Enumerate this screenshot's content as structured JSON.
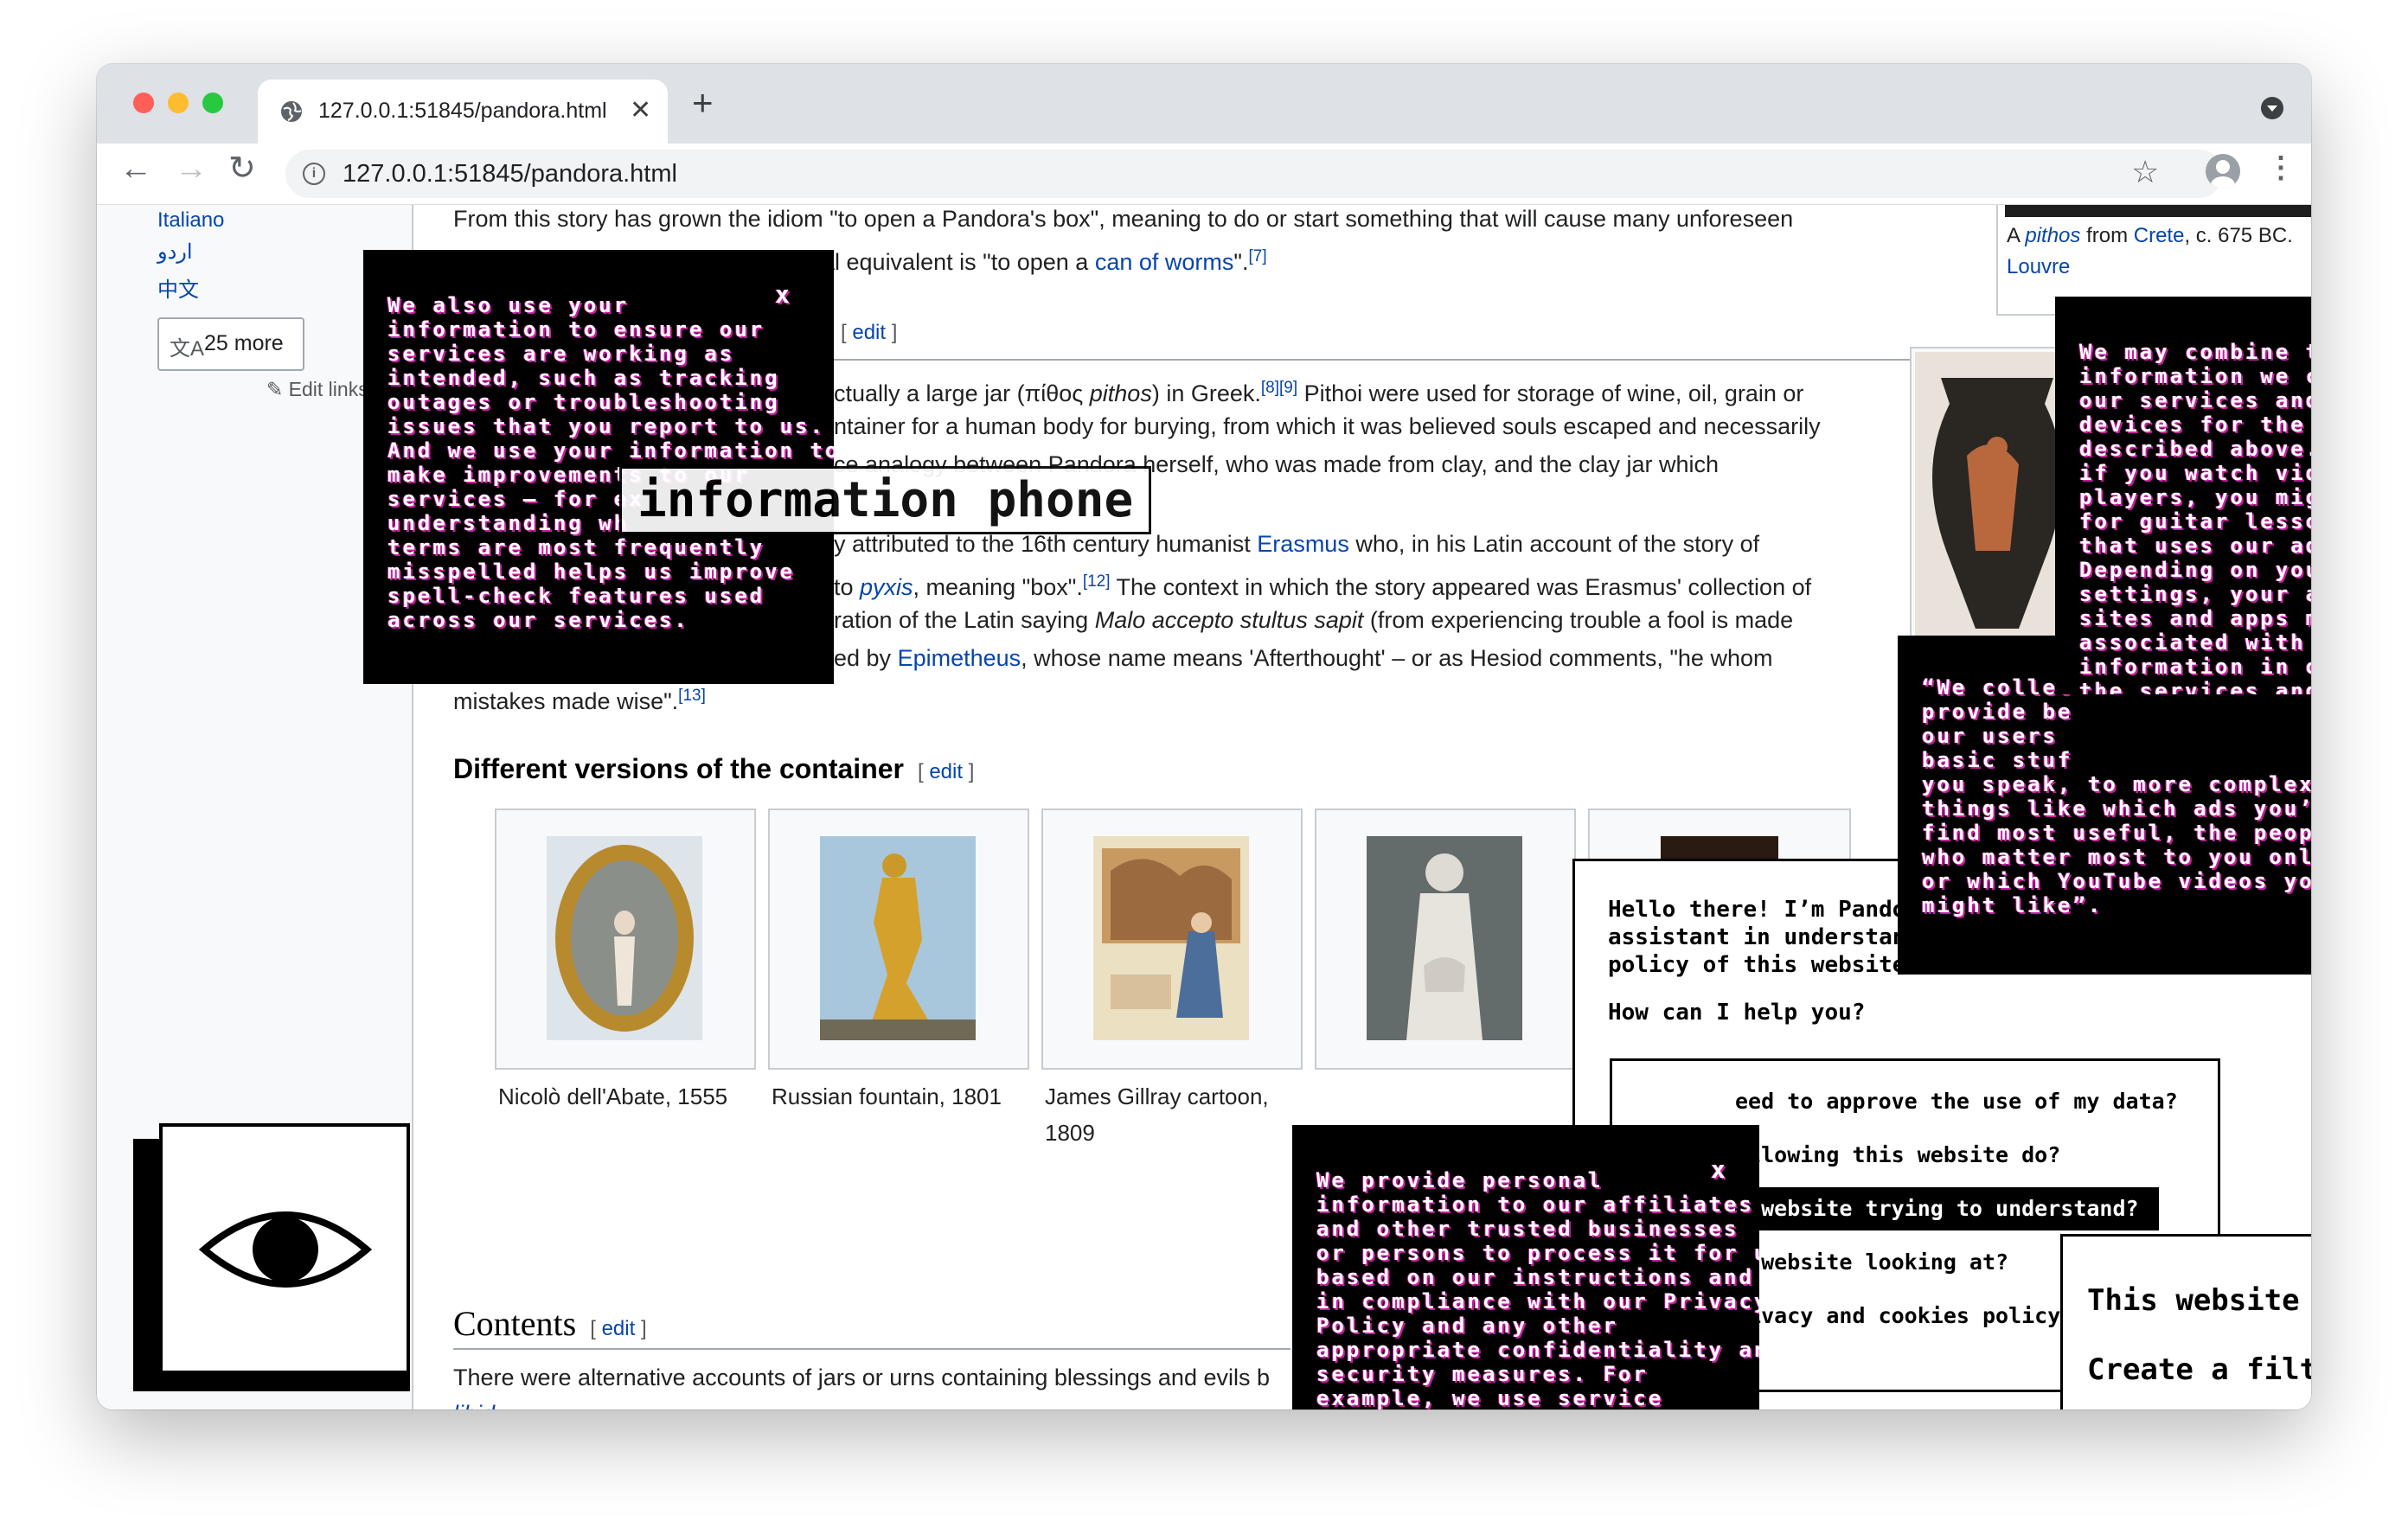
{
  "browser": {
    "tab_title": "127.0.0.1:51845/pandora.html",
    "tab_close": "✕",
    "new_tab": "+",
    "url": "127.0.0.1:51845/pandora.html",
    "star": "☆",
    "kebab": "⋮",
    "back": "←",
    "forward": "→",
    "reload": "↻",
    "info_glyph": "i"
  },
  "sidebar": {
    "languages": [
      "Italiano",
      "اردو",
      "中文"
    ],
    "more_icon": "文A",
    "more_label": "25 more",
    "edit_links": "✎ Edit links"
  },
  "article": {
    "p1_a": "From this story has grown the idiom \"to open a Pandora's box\", meaning to do or start something that will cause many unforeseen",
    "p1_b": "ial equivalent is \"to open a ",
    "p1_link": "can of worms",
    "p1_c": "\".",
    "p1_ref": "[7]",
    "edit": "edit",
    "p2_a": "ctually a large jar (πίθος ",
    "p2_italic": "pithos",
    "p2_b": ") in Greek.",
    "p2_ref": "[8][9]",
    "p2_c": " Pithoi were used for storage of wine, oil, grain or",
    "p3": "ntainer for a human body for burying, from which it was believed souls escaped and necessarily",
    "p4": "ce analogy between Pandora herself, who was made from clay, and the clay jar which",
    "p5_a": "y attributed to the 16th century humanist ",
    "p5_link": "Erasmus",
    "p5_b": " who, in his Latin account of the story of",
    "p6_a": "to ",
    "p6_italic": "pyxis",
    "p6_b": ", meaning \"box\".",
    "p6_ref": "[12]",
    "p6_c": " The context in which the story appeared was Erasmus' collection of",
    "p7_a": "ration of the Latin saying ",
    "p7_italic": "Malo accepto stultus sapit",
    "p7_b": " (from experiencing trouble a fool is made",
    "p8_a": "ed by ",
    "p8_link": "Epimetheus",
    "p8_b": ", whose name means 'Afterthought' – or as Hesiod comments, \"he whom",
    "p9": "mistakes made wise\".",
    "p9_ref": "[13]",
    "h_versions": "Different versions of the container",
    "gallery": [
      {
        "caption": "Nicolò dell'Abate, 1555"
      },
      {
        "caption": "Russian fountain, 1801"
      },
      {
        "caption": "James Gillray cartoon, 1809"
      },
      {
        "caption": ""
      }
    ],
    "contents": "Contents",
    "p10": "There were alternative accounts of jars or urns containing blessings and evils b",
    "p11": "libid",
    "infobox_caption_a": "A ",
    "infobox_caption_italic": "pithos",
    "infobox_caption_b": " from ",
    "infobox_caption_link1": "Crete",
    "infobox_caption_c": ", c. 675 BC.",
    "infobox_caption_link2": "Louvre"
  },
  "overlays": {
    "popup_left": "We also use your\ninformation to ensure our\nservices are working as\nintended, such as tracking\noutages or troubleshooting\nissues that you report to us.\nAnd we use your information to\nmake improvements to our\nservices — for ex\nunderstanding wh\nterms are most frequently\nmisspelled helps us improve\nspell-check features used\nacross our services.",
    "popup_close": "x",
    "big_tooltip": "information phone",
    "popup_right_top": "We may combine t\ninformation we co\nour services and \ndevices for the pu\ndescribed above. \nif you watch video\nplayers, you migh\nfor guitar lessons\nthat uses our ad p\nDepending on you\nsettings, your act\nsites and apps ma\nassociated with y\ninformation in ord\nthe services and t\ndelivered.",
    "popup_right_mid": "“We collec\nprovide be\nour users \nbasic stuf\nyou speak, to more complex\nthings like which ads you’ll\nfind most useful, the people\nwho matter most to you online,\nor which YouTube videos you\nmight like”.",
    "popup_bottom": "We provide personal\ninformation to our affiliates\nand other trusted businesses\nor persons to process it for us,\nbased on our instructions and\nin compliance with our Privacy\nPolicy and any other\nappropriate confidentiality and\nsecurity measures. For\nexample, we use service\nproviders to help us with\ncustomer support.",
    "assistant": {
      "greeting": "Hello there! I’m Pandora,\nassistant in understandin\npolicy of this website!",
      "question": "How can I help you?",
      "options": [
        "eed to approve the use of my data?",
        "allowing this website do?",
        "s website trying to understand?",
        "s website looking at?",
        "rivacy and cookies policy a"
      ],
      "panel_line1": "This website is",
      "panel_line2": "Create a filter"
    }
  },
  "colors": {
    "link": "#0645ad",
    "glitch": "#c41ea0",
    "close_red": "#ff5f57",
    "min_yellow": "#febc2e",
    "max_green": "#28c840"
  }
}
